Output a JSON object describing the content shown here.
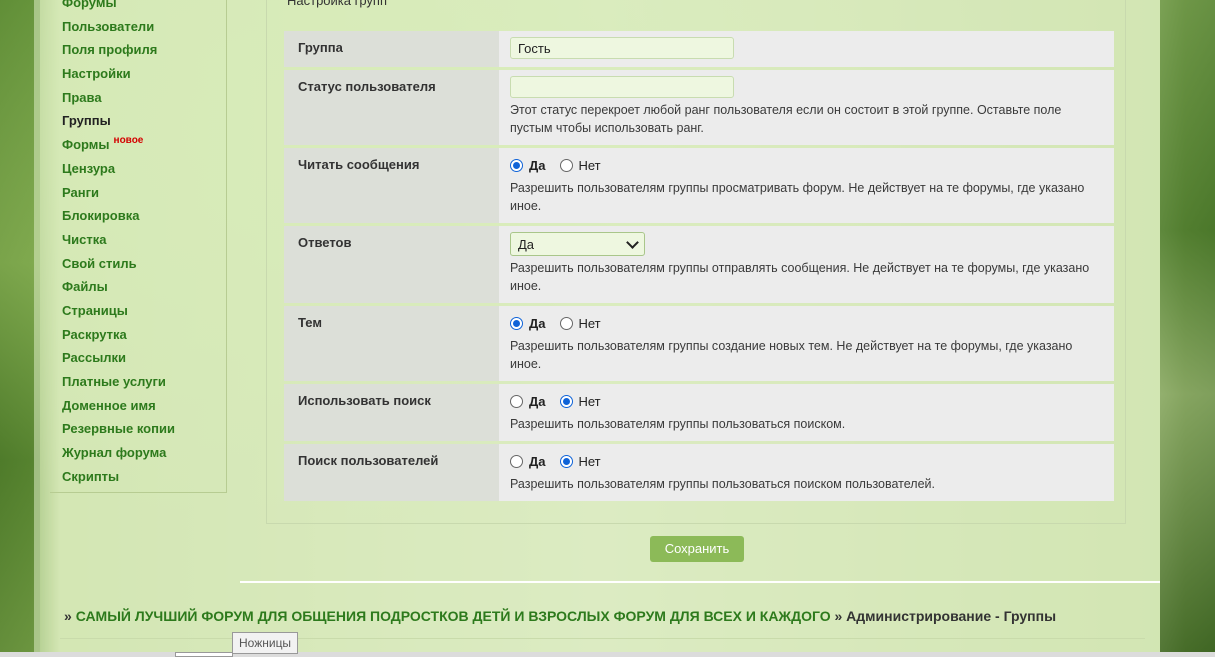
{
  "sidebar": {
    "items": [
      {
        "label": "Форумы"
      },
      {
        "label": "Пользователи"
      },
      {
        "label": "Поля профиля"
      },
      {
        "label": "Настройки"
      },
      {
        "label": "Права"
      },
      {
        "label": "Группы"
      },
      {
        "label": "Формы",
        "badge": "новое"
      },
      {
        "label": "Цензура"
      },
      {
        "label": "Ранги"
      },
      {
        "label": "Блокировка"
      },
      {
        "label": "Чистка"
      },
      {
        "label": "Свой стиль"
      },
      {
        "label": "Файлы"
      },
      {
        "label": "Страницы"
      },
      {
        "label": "Раскрутка"
      },
      {
        "label": "Рассылки"
      },
      {
        "label": "Платные услуги"
      },
      {
        "label": "Доменное имя"
      },
      {
        "label": "Резервные копии"
      },
      {
        "label": "Журнал форума"
      },
      {
        "label": "Скрипты"
      }
    ],
    "active": "Группы"
  },
  "fieldset": {
    "legend": "Настройка групп"
  },
  "form": {
    "group": {
      "label": "Группа",
      "value": "Гость"
    },
    "status": {
      "label": "Статус пользователя",
      "value": "",
      "help": "Этот статус перекроет любой ранг пользователя если он состоит в этой группе. Оставьте поле пустым чтобы использовать ранг."
    },
    "read": {
      "label": "Читать сообщения",
      "yes": "Да",
      "no": "Нет",
      "selected": "yes",
      "help": "Разрешить пользователям группы просматривать форум. Не действует на те форумы, где указано иное."
    },
    "replies": {
      "label": "Ответов",
      "selected": "Да",
      "help": "Разрешить пользователям группы отправлять сообщения. Не действует на те форумы, где указано иное."
    },
    "topics": {
      "label": "Тем",
      "yes": "Да",
      "no": "Нет",
      "selected": "yes",
      "help": "Разрешить пользователям группы создание новых тем. Не действует на те форумы, где указано иное."
    },
    "search": {
      "label": "Использовать поиск",
      "yes": "Да",
      "no": "Нет",
      "selected": "no",
      "help": "Разрешить пользователям группы пользоваться поиском."
    },
    "user_search": {
      "label": "Поиск пользователей",
      "yes": "Да",
      "no": "Нет",
      "selected": "no",
      "help": "Разрешить пользователям группы пользоваться поиском пользователей."
    }
  },
  "save_label": "Сохранить",
  "breadcrumb": {
    "sep1": "»",
    "forum_link": "САМЫЙ ЛУЧШИЙ ФОРУМ ДЛЯ ОБЩЕНИЯ ПОДРОСТКОВ ДЕТЙ И ВЗРОСЛЫХ ФОРУМ ДЛЯ ВСЕХ И КАЖДОГО",
    "sep2": "»",
    "current": "Администрирование - Группы"
  },
  "tooltip": "Ножницы",
  "colors": {
    "accent": "#2d7a1c",
    "button": "#8cba58",
    "badge": "#d40000",
    "radio_checked": "#0f63d8"
  }
}
